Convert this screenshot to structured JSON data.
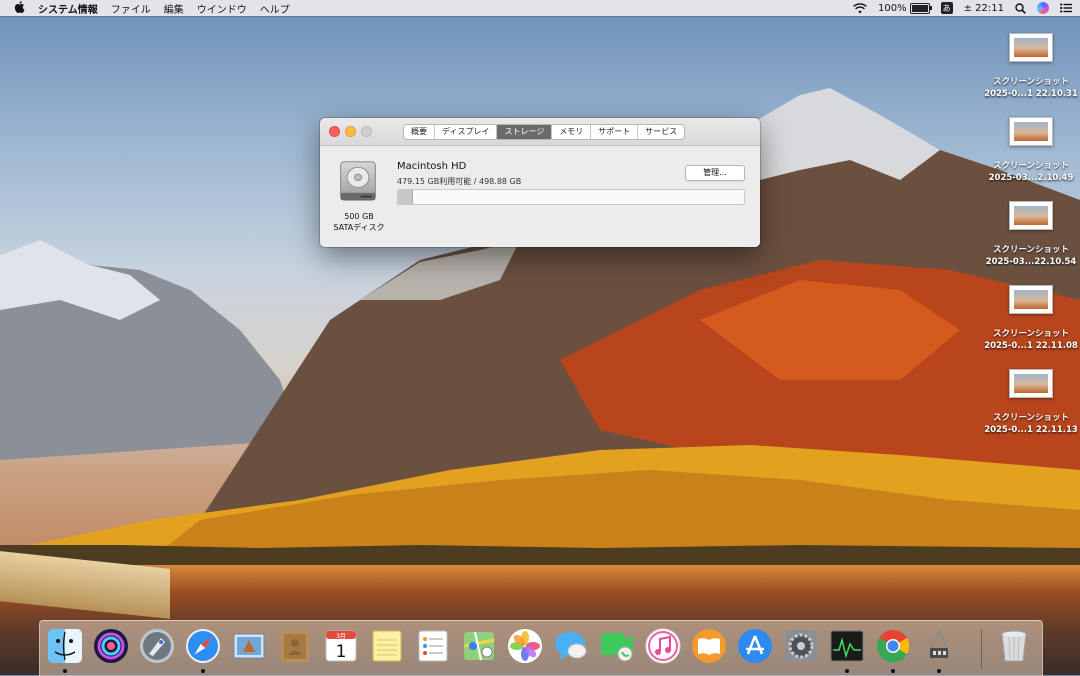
{
  "menubar": {
    "app_name": "システム情報",
    "items": [
      "ファイル",
      "編集",
      "ウインドウ",
      "ヘルプ"
    ],
    "battery": "100%",
    "input_method": "あ",
    "clock": "± 22:11"
  },
  "desktop_icons": [
    {
      "line1": "スクリーンショット",
      "line2": "2025-0...1 22.10.31"
    },
    {
      "line1": "スクリーンショット",
      "line2": "2025-03...2.10.49"
    },
    {
      "line1": "スクリーンショット",
      "line2": "2025-03...22.10.54"
    },
    {
      "line1": "スクリーンショット",
      "line2": "2025-0...1 22.11.08"
    },
    {
      "line1": "スクリーンショット",
      "line2": "2025-0...1 22.11.13"
    }
  ],
  "window": {
    "tabs": [
      "概要",
      "ディスプレイ",
      "ストレージ",
      "メモリ",
      "サポート",
      "サービス"
    ],
    "active_tab": "ストレージ",
    "disk": {
      "capacity": "500 GB",
      "type": "SATAディスク",
      "name": "Macintosh HD",
      "availability": "479.15 GB利用可能 / 498.88 GB",
      "used_fraction": 0.04
    },
    "manage_label": "管理..."
  },
  "dock": {
    "items": [
      {
        "name": "finder",
        "running": true
      },
      {
        "name": "siri",
        "running": false
      },
      {
        "name": "launchpad",
        "running": false
      },
      {
        "name": "safari",
        "running": true
      },
      {
        "name": "mail",
        "running": false
      },
      {
        "name": "contacts",
        "running": false
      },
      {
        "name": "calendar",
        "running": false,
        "month": "3月",
        "day": "1"
      },
      {
        "name": "notes",
        "running": false
      },
      {
        "name": "reminders",
        "running": false
      },
      {
        "name": "maps",
        "running": false
      },
      {
        "name": "photos",
        "running": false
      },
      {
        "name": "messages",
        "running": false
      },
      {
        "name": "facetime",
        "running": false
      },
      {
        "name": "itunes",
        "running": false
      },
      {
        "name": "ibooks",
        "running": false
      },
      {
        "name": "app-store",
        "running": false
      },
      {
        "name": "system-preferences",
        "running": false
      },
      {
        "name": "activity-monitor",
        "running": true
      },
      {
        "name": "chrome",
        "running": true
      },
      {
        "name": "system-information",
        "running": true
      },
      {
        "name": "trash",
        "running": false
      }
    ]
  },
  "colors": {
    "close": "#fc605c",
    "minimize": "#fdbc40",
    "active_tab": "#6b6b6b"
  }
}
